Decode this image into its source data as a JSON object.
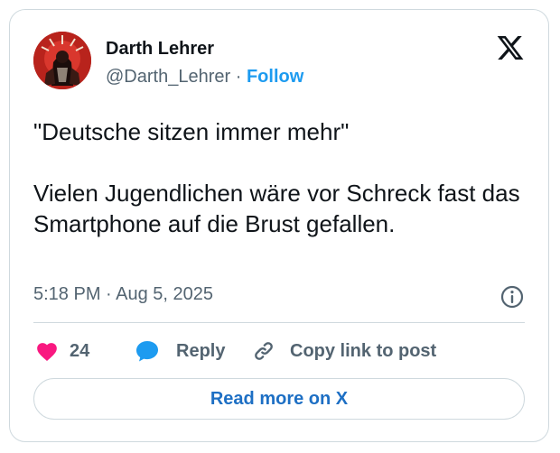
{
  "author": {
    "name": "Darth Lehrer",
    "handle": "@Darth_Lehrer",
    "separator": "·",
    "follow_label": "Follow",
    "avatar_icon": "avatar-illustration"
  },
  "brand": {
    "logo_icon": "x-logo-icon"
  },
  "tweet": {
    "line1": "\"Deutsche sitzen immer mehr\"",
    "line2": "Vielen Jugendlichen wäre vor Schreck fast das Smartphone auf die Brust gefallen."
  },
  "meta": {
    "timestamp": "5:18 PM · Aug 5, 2025",
    "info_icon": "info-icon"
  },
  "actions": {
    "like_count": "24",
    "like_icon": "heart-icon",
    "reply_label": "Reply",
    "reply_icon": "speech-bubble-icon",
    "copy_label": "Copy link to post",
    "copy_icon": "link-icon"
  },
  "footer": {
    "read_more_label": "Read more on X"
  },
  "colors": {
    "accent": "#1d9bf0",
    "link_dark": "#1d6fc4",
    "like": "#f91880",
    "muted": "#536471",
    "border": "#cfd9de",
    "avatar_bg": "#b8231c"
  }
}
